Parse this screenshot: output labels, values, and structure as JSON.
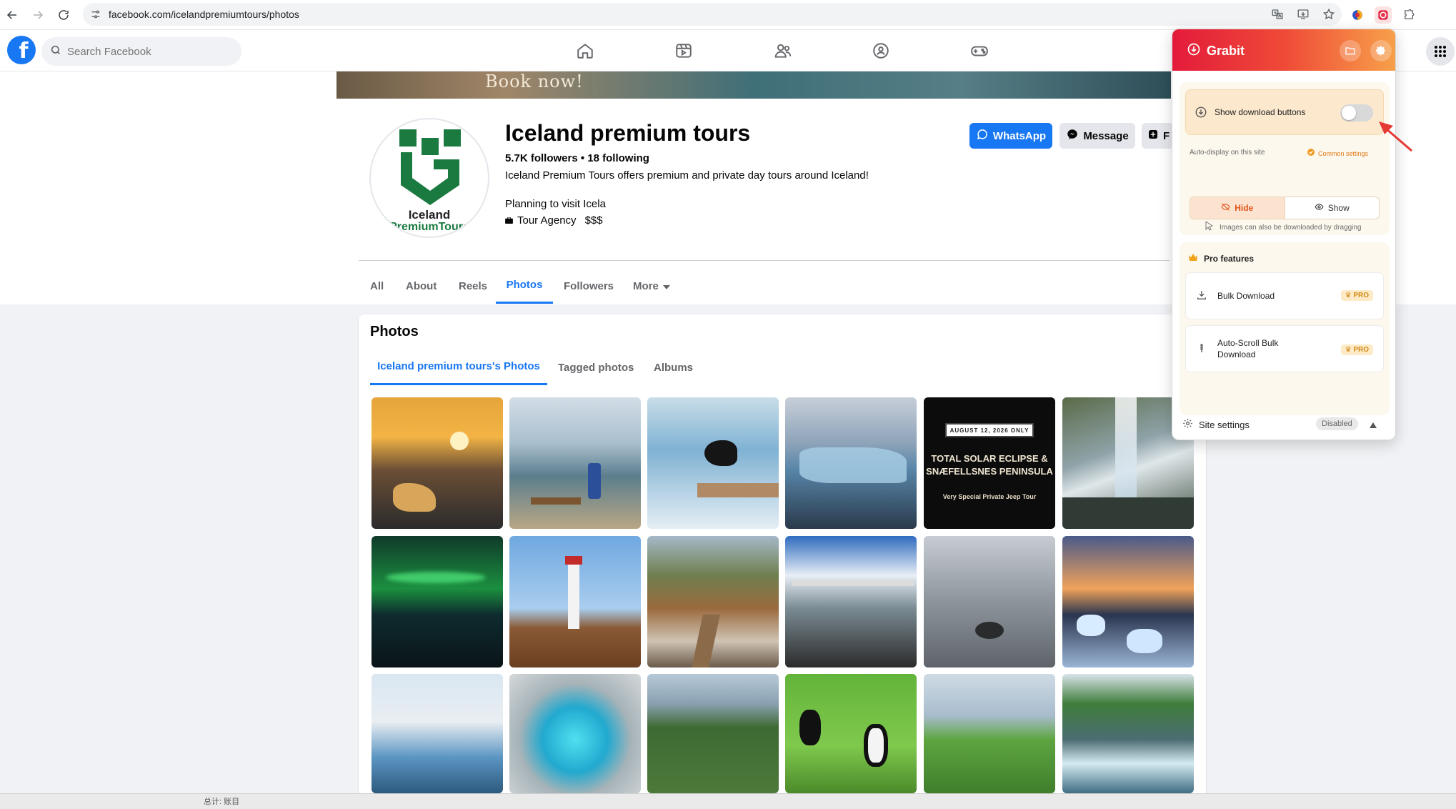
{
  "browser": {
    "url": "facebook.com/icelandpremiumtours/photos"
  },
  "fb": {
    "search_placeholder": "Search Facebook"
  },
  "cover": {
    "text": "Book now!"
  },
  "page": {
    "name": "Iceland premium tours",
    "logo_line1": "Iceland",
    "logo_line2": "PremiumTours",
    "followers": "5.7K followers • 18 following",
    "intro": "Iceland Premium Tours offers premium and private day tours around Iceland!",
    "planning": "Planning to visit Icela",
    "category": "Tour Agency",
    "price": "$$$",
    "whatsapp_label": "WhatsApp",
    "message_label": "Message",
    "third_label": "F"
  },
  "tabs": [
    "All",
    "About",
    "Reels",
    "Photos",
    "Followers",
    "More"
  ],
  "photos_card": {
    "title": "Photos",
    "subtabs": [
      "Iceland premium tours's Photos",
      "Tagged photos",
      "Albums"
    ]
  },
  "eclipse": {
    "date": "AUGUST 12, 2026 ONLY",
    "line1": "TOTAL SOLAR ECLIPSE &",
    "line2": "SNÆFELLSNES PENINSULA",
    "sub": "Very Special Private Jeep Tour"
  },
  "taskbar": {
    "text": "总计: 账目"
  },
  "grabit": {
    "title": "Grabit",
    "toggle_label": "Show download buttons",
    "toggle_on": false,
    "auto_display": "Auto-display on this site",
    "common_settings": "Common settings",
    "hide_label": "Hide",
    "show_label": "Show",
    "drag_hint": "Images can also be downloaded by dragging",
    "pro_title": "Pro features",
    "bulk_download": "Bulk Download",
    "auto_scroll": "Auto-Scroll Bulk Download",
    "pro_badge": "PRO",
    "site_settings": "Site settings",
    "site_status": "Disabled"
  },
  "colors": {
    "fb_blue": "#1877f2",
    "grabit_red": "#e31b3b",
    "grabit_orange": "#f7a14a"
  }
}
